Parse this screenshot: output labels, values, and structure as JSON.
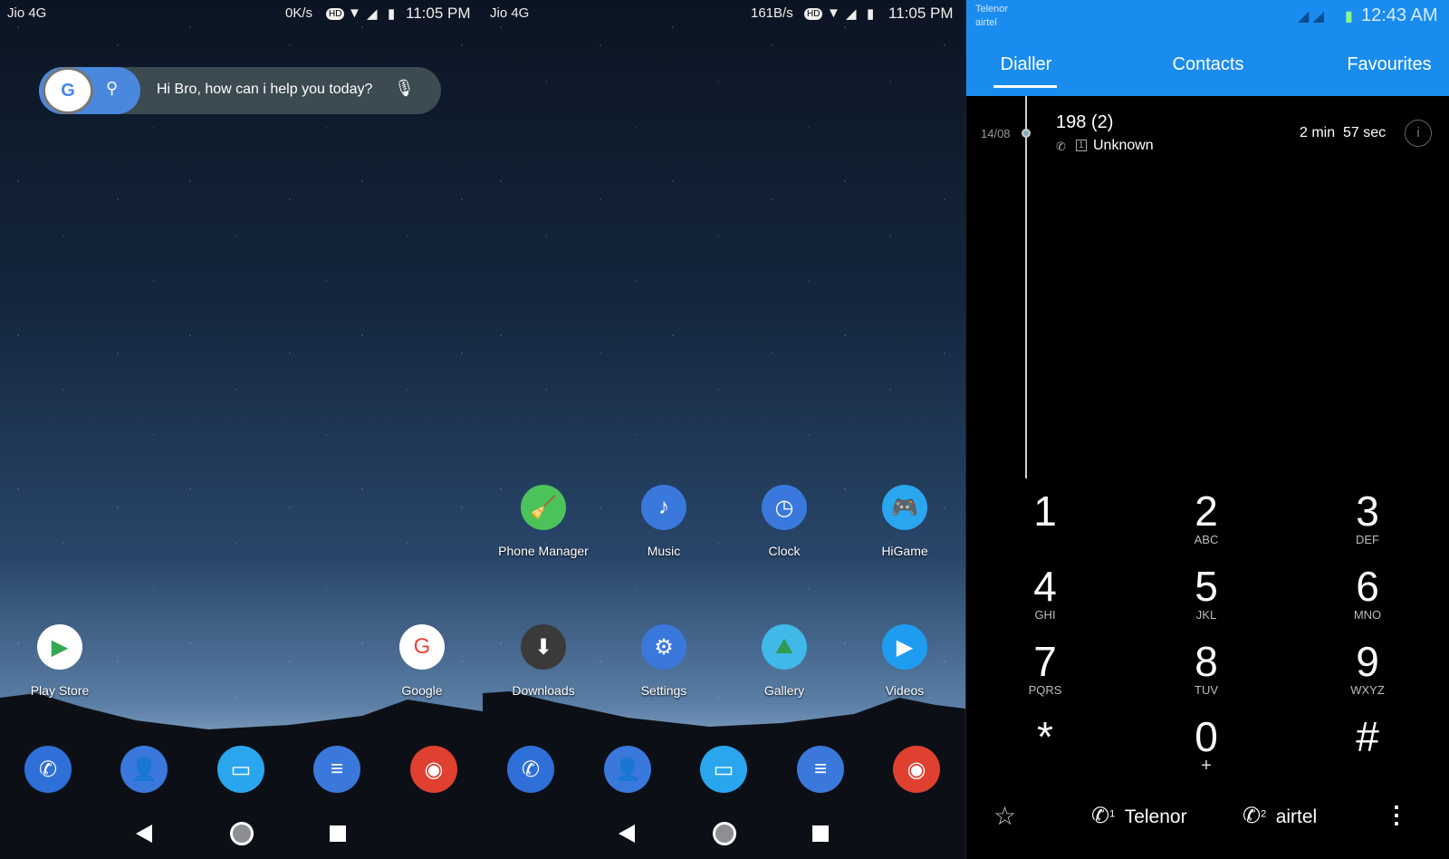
{
  "screen1": {
    "status": {
      "carrier": "Jio 4G",
      "speed": "0K/s",
      "hd": "HD",
      "time": "11:05 PM"
    },
    "search": {
      "g": "G",
      "placeholder": "Hi Bro, how can i help you today?"
    },
    "apps": [
      {
        "label": "Play Store",
        "icon": "play-store-icon",
        "color": "#ffffff",
        "glyph": "▶",
        "fg": "#34a853"
      },
      {
        "label": "Google",
        "icon": "google-icon",
        "color": "#ffffff",
        "glyph": "G",
        "fg": "#ea4335"
      }
    ]
  },
  "screen2": {
    "status": {
      "carrier": "Jio 4G",
      "speed": "161B/s",
      "hd": "HD",
      "time": "11:05 PM"
    },
    "apps": [
      {
        "label": "Phone Manager",
        "icon": "broom-icon",
        "color": "#4cc25a",
        "glyph": "🧹",
        "fg": "#fff"
      },
      {
        "label": "Music",
        "icon": "music-note-icon",
        "color": "#3a78dc",
        "glyph": "♪",
        "fg": "#fff"
      },
      {
        "label": "Clock",
        "icon": "clock-icon",
        "color": "#3a78dc",
        "glyph": "◷",
        "fg": "#fff"
      },
      {
        "label": "HiGame",
        "icon": "gamepad-icon",
        "color": "#2aa6ee",
        "glyph": "🎮",
        "fg": "#fff"
      },
      {
        "label": "Downloads",
        "icon": "download-icon",
        "color": "#3a3a3a",
        "glyph": "⬇",
        "fg": "#fff"
      },
      {
        "label": "Settings",
        "icon": "gear-icon",
        "color": "#3a78dc",
        "glyph": "⚙",
        "fg": "#fff"
      },
      {
        "label": "Gallery",
        "icon": "gallery-icon",
        "color": "#40b8e8",
        "glyph": "⛰",
        "fg": "#2e9a52"
      },
      {
        "label": "Videos",
        "icon": "play-icon",
        "color": "#1e9cf0",
        "glyph": "▶",
        "fg": "#fff"
      }
    ]
  },
  "dock": [
    {
      "icon": "phone-icon",
      "color": "#2f6fd8",
      "glyph": "✆"
    },
    {
      "icon": "contacts-icon",
      "color": "#3a78dc",
      "glyph": "👤"
    },
    {
      "icon": "files-icon",
      "color": "#2aa6ee",
      "glyph": "▭"
    },
    {
      "icon": "messages-icon",
      "color": "#3a78dc",
      "glyph": "≡"
    },
    {
      "icon": "chrome-icon",
      "color": "#e04030",
      "glyph": "◉"
    }
  ],
  "dialler": {
    "status": {
      "sim1": "Telenor",
      "sim2": "airtel",
      "time": "12:43 AM"
    },
    "tabs": [
      {
        "label": "Dialler",
        "active": true
      },
      {
        "label": "Contacts"
      },
      {
        "label": "Favourites"
      }
    ],
    "call_log": [
      {
        "date": "14/08",
        "number": "198 (2)",
        "sim": "1",
        "location": "Unknown",
        "duration": "2 min  57 sec"
      }
    ],
    "keys": [
      {
        "d": "1",
        "l": ""
      },
      {
        "d": "2",
        "l": "ABC"
      },
      {
        "d": "3",
        "l": "DEF"
      },
      {
        "d": "4",
        "l": "GHI"
      },
      {
        "d": "5",
        "l": "JKL"
      },
      {
        "d": "6",
        "l": "MNO"
      },
      {
        "d": "7",
        "l": "PQRS"
      },
      {
        "d": "8",
        "l": "TUV"
      },
      {
        "d": "9",
        "l": "WXYZ"
      },
      {
        "d": "*",
        "l": ""
      },
      {
        "d": "0",
        "l": "+"
      },
      {
        "d": "#",
        "l": ""
      }
    ],
    "bottom": {
      "sim1_label": "Telenor",
      "sim1_num": "1",
      "sim2_label": "airtel",
      "sim2_num": "2"
    },
    "accent": "#1a8cf0"
  }
}
